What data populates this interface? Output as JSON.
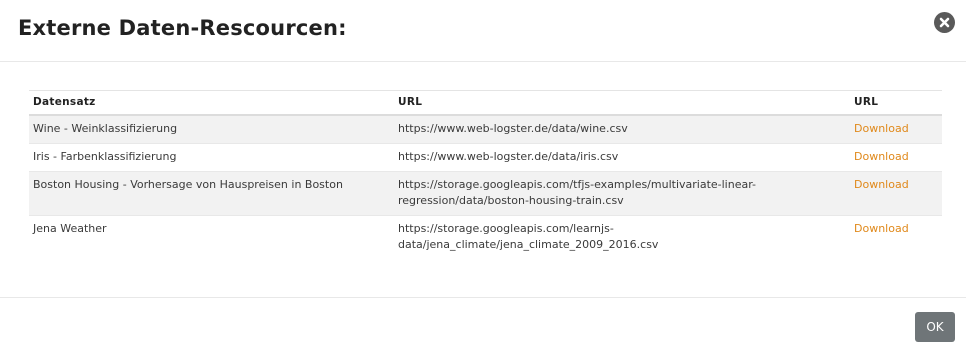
{
  "modal": {
    "title": "Externe Daten-Rescourcen:",
    "close_icon": "close-circle-icon"
  },
  "table": {
    "headers": {
      "dataset": "Datensatz",
      "url": "URL",
      "download": "URL"
    },
    "rows": [
      {
        "dataset": "Wine - Weinklassifizierung",
        "url": "https://www.web-logster.de/data/wine.csv",
        "link": "Download"
      },
      {
        "dataset": "Iris - Farbenklassifizierung",
        "url": "https://www.web-logster.de/data/iris.csv",
        "link": "Download"
      },
      {
        "dataset": "Boston Housing - Vorhersage von Hauspreisen in Boston",
        "url": "https://storage.googleapis.com/tfjs-examples/multivariate-linear-regression/data/boston-housing-train.csv",
        "link": "Download"
      },
      {
        "dataset": "Jena Weather",
        "url": "https://storage.googleapis.com/learnjs-data/jena_climate/jena_climate_2009_2016.csv",
        "link": "Download"
      }
    ]
  },
  "footer": {
    "ok_label": "OK"
  },
  "colors": {
    "link": "#e0891b",
    "ok_button": "#6f7578",
    "close_icon": "#5a5a5a"
  }
}
